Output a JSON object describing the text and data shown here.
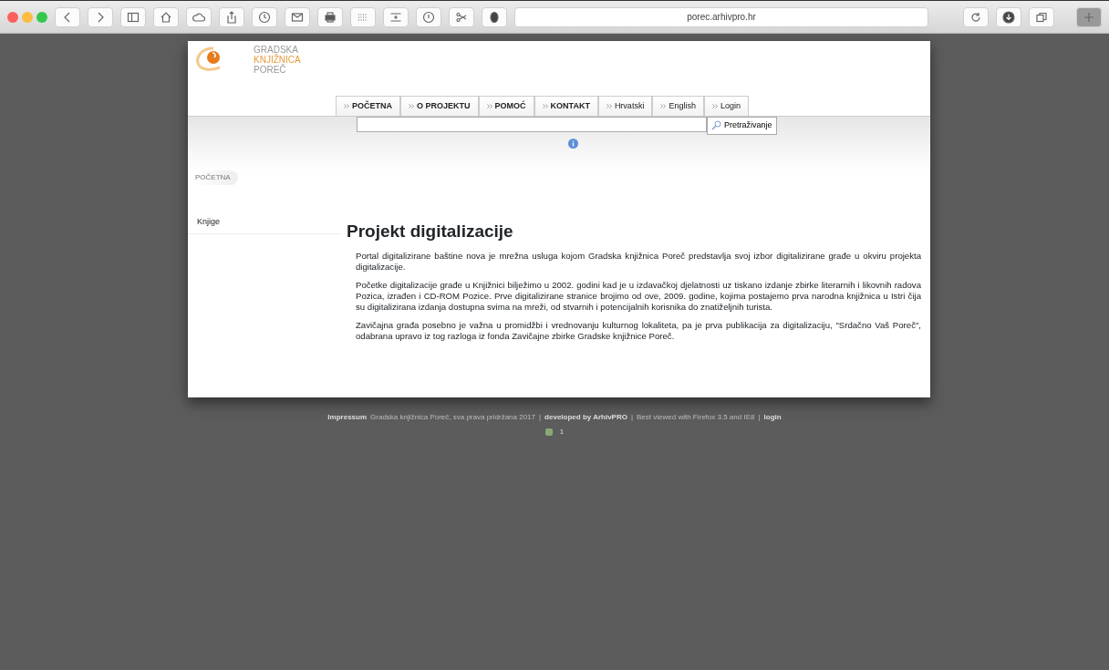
{
  "browser": {
    "url": "porec.arhivpro.hr"
  },
  "logo": {
    "lines": [
      "GRADSKA",
      "KNJIŽNICA",
      "POREČ"
    ]
  },
  "nav": [
    {
      "label": "POČETNA"
    },
    {
      "label": "O PROJEKTU"
    },
    {
      "label": "POMOĆ"
    },
    {
      "label": "KONTAKT"
    },
    {
      "label": "Hrvatski"
    },
    {
      "label": "English"
    },
    {
      "label": "Login"
    }
  ],
  "search": {
    "button": "Pretraživanje"
  },
  "breadcrumb": "POČETNA",
  "sidebar": {
    "items": [
      "Knjige"
    ]
  },
  "content": {
    "title": "Projekt digitalizacije",
    "paragraphs": [
      "Portal digitalizirane baštine nova je mrežna usluga kojom Gradska knjižnica Poreč predstavlja svoj izbor digitalizirane građe u okviru projekta digitalizacije.",
      "Početke digitalizacije građe u Knjižnici bilježimo u 2002. godini kad je u izdavačkoj djelatnosti uz tiskano izdanje zbirke literarnih i likovnih radova Pozica, izrađen i CD-ROM Pozice. Prve digitalizirane stranice brojimo od ove, 2009. godine, kojima postajemo prva narodna knjižnica u Istri čija su digitalizirana izdanja dostupna svima na mreži, od stvarnih i potencijalnih korisnika do znatiželjnih turista.",
      "Zavičajna građa posebno je važna u promidžbi i vrednovanju kulturnog lokaliteta, pa je prva publikacija za digitalizaciju, \"Srdačno Vaš Poreč\", odabrana upravo iz tog razloga iz fonda Zavičajne zbirke Gradske knjižnice Poreč."
    ]
  },
  "footer": {
    "parts": [
      {
        "kind": "link",
        "text": "Impressum"
      },
      {
        "kind": "plain",
        "text": "Gradska knjižnica Poreč, sva prava pridržana 2017"
      },
      {
        "kind": "plain",
        "text": "|"
      },
      {
        "kind": "link",
        "text": "developed by ArhivPRO"
      },
      {
        "kind": "plain",
        "text": "|"
      },
      {
        "kind": "plain",
        "text": "Best viewed with Firefox 3.5 and IE8"
      },
      {
        "kind": "plain",
        "text": "|"
      },
      {
        "kind": "link",
        "text": "login"
      }
    ],
    "counter": "1"
  }
}
